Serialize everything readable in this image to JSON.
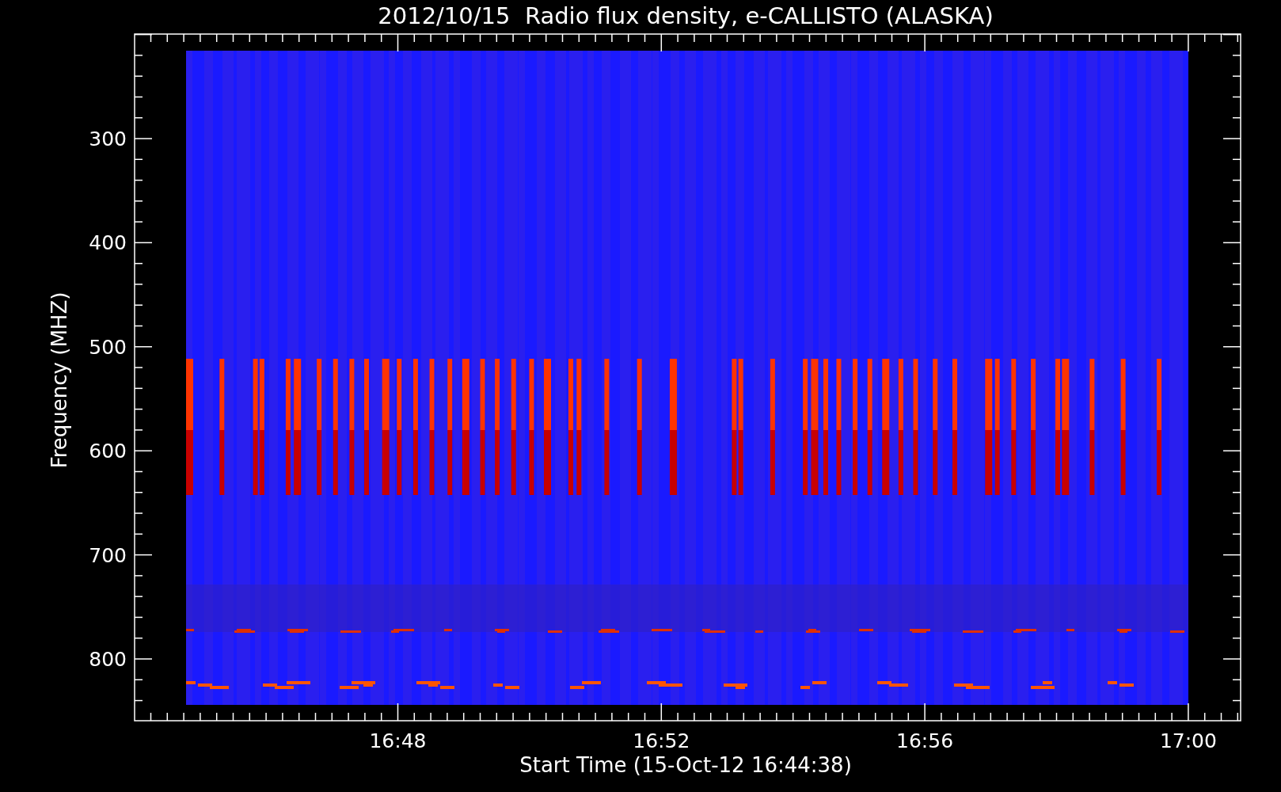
{
  "title": "2012/10/15  Radio flux density, e-CALLISTO (ALASKA)",
  "plot": {
    "ylabel": "Frequency (MHZ)",
    "xlabel": "Start Time (15-Oct-12 16:44:38)",
    "yticks": [
      "300",
      "400",
      "500",
      "600",
      "700",
      "800"
    ],
    "xticks": [
      "16:48",
      "16:52",
      "16:56",
      "17:00"
    ]
  }
}
